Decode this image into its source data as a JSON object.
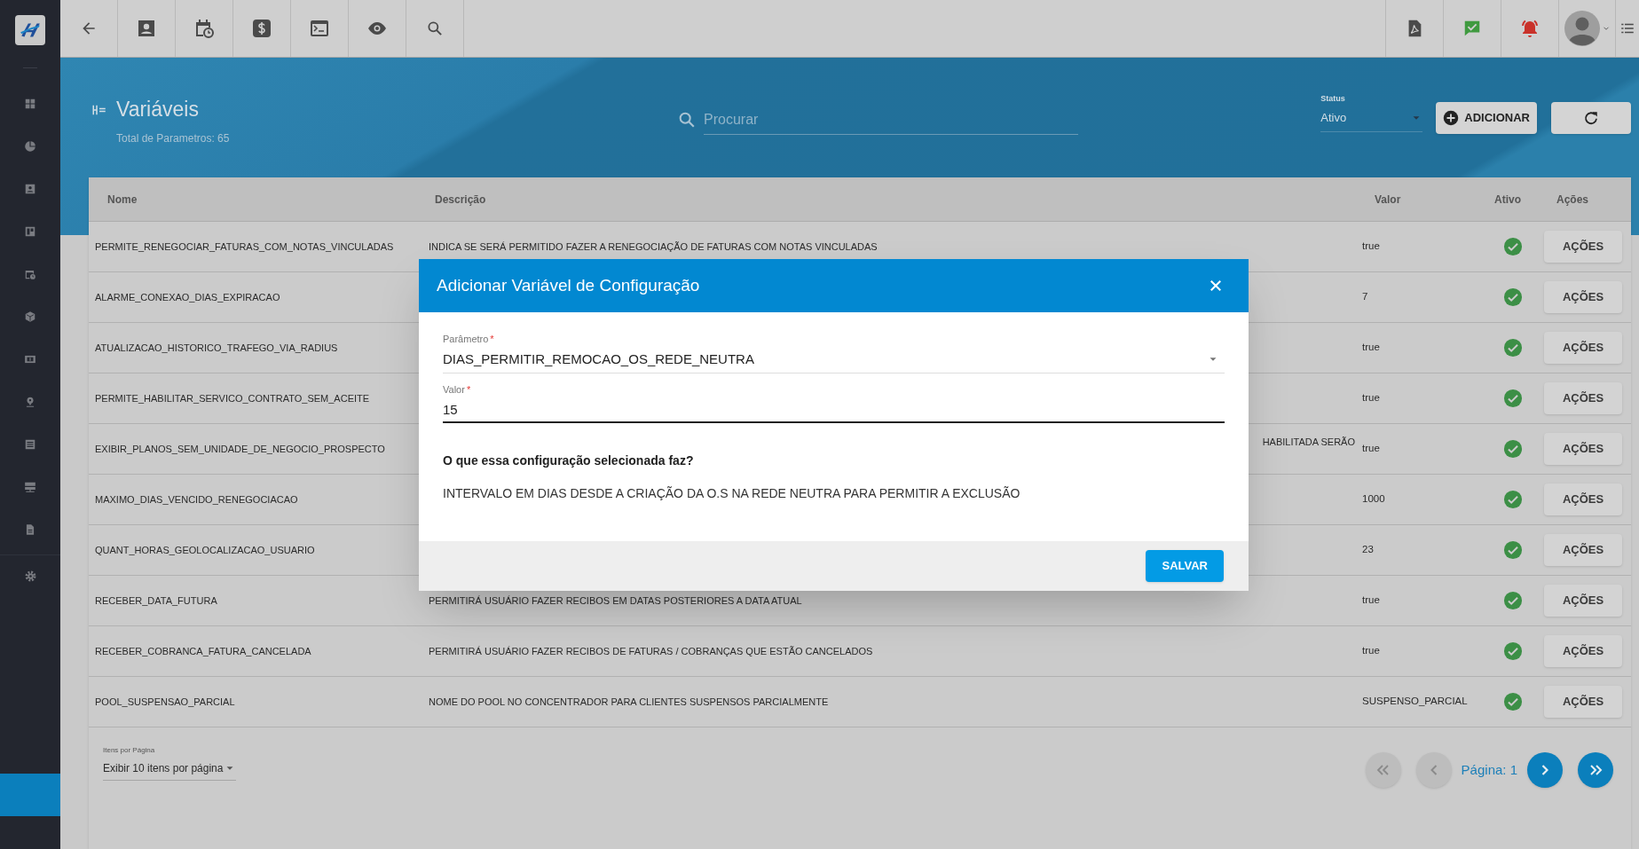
{
  "header": {
    "title": "Variáveis",
    "subtitle": "Total de Parametros: 65",
    "search": {
      "placeholder": "Procurar"
    },
    "status": {
      "label": "Status",
      "value": "Ativo"
    },
    "add_button": "ADICIONAR"
  },
  "table": {
    "columns": [
      "Nome",
      "Descrição",
      "Valor",
      "Ativo",
      "Ações"
    ],
    "rows": [
      {
        "name": "PERMITE_RENEGOCIAR_FATURAS_COM_NOTAS_VINCULADAS",
        "description": "INDICA SE SERÁ PERMITIDO FAZER A RENEGOCIAÇÃO DE FATURAS COM NOTAS VINCULADAS",
        "value": "true",
        "active": true,
        "action": "AÇÕES"
      },
      {
        "name": "ALARME_CONEXAO_DIAS_EXPIRACAO",
        "value": "7",
        "active": true,
        "action": "AÇÕES"
      },
      {
        "name": "ATUALIZACAO_HISTORICO_TRAFEGO_VIA_RADIUS",
        "value": "true",
        "active": true,
        "action": "AÇÕES"
      },
      {
        "name": "PERMITE_HABILITAR_SERVICO_CONTRATO_SEM_ACEITE",
        "value": "true",
        "active": true,
        "action": "AÇÕES"
      },
      {
        "name": "EXIBIR_PLANOS_SEM_UNIDADE_DE_NEGOCIO_PROSPECTO",
        "description_tail": "HABILITADA SERÃO",
        "value": "true",
        "active": true,
        "action": "AÇÕES"
      },
      {
        "name": "MAXIMO_DIAS_VENCIDO_RENEGOCIACAO",
        "value": "1000",
        "active": true,
        "action": "AÇÕES"
      },
      {
        "name": "QUANT_HORAS_GEOLOCALIZACAO_USUARIO",
        "value": "23",
        "active": true,
        "action": "AÇÕES"
      },
      {
        "name": "RECEBER_DATA_FUTURA",
        "description": "PERMITIRÁ USUÁRIO FAZER RECIBOS EM DATAS POSTERIORES A DATA ATUAL",
        "value": "true",
        "active": true,
        "action": "AÇÕES"
      },
      {
        "name": "RECEBER_COBRANCA_FATURA_CANCELADA",
        "description": "PERMITIRÁ USUÁRIO FAZER RECIBOS DE FATURAS / COBRANÇAS QUE ESTÃO CANCELADOS",
        "value": "true",
        "active": true,
        "action": "AÇÕES"
      },
      {
        "name": "POOL_SUSPENSAO_PARCIAL",
        "description": "NOME DO POOL NO CONCENTRADOR PARA CLIENTES SUSPENSOS PARCIALMENTE",
        "value": "SUSPENSO_PARCIAL",
        "active": true,
        "action": "AÇÕES"
      }
    ]
  },
  "pagination": {
    "label": "Itens por Página",
    "value": "Exibir 10 itens por página",
    "page": "Página: 1",
    "nav_buttons": [
      {
        "kind": "first",
        "disabled": true
      },
      {
        "kind": "prev",
        "disabled": true
      },
      {
        "kind": "page"
      },
      {
        "kind": "next",
        "disabled": false
      },
      {
        "kind": "last",
        "disabled": false
      }
    ]
  },
  "dialog": {
    "title": "Adicionar Variável de Configuração",
    "fields": [
      {
        "kind": "select",
        "label": "Parâmetro",
        "required_mark": "*",
        "value": "DIAS_PERMITIR_REMOCAO_OS_REDE_NEUTRA"
      },
      {
        "kind": "input",
        "label": "Valor",
        "required_mark": "*",
        "value": "15",
        "focused": true
      }
    ],
    "question": "O que essa configuração selecionada faz?",
    "answer": "INTERVALO EM DIAS DESDE A CRIAÇÃO DA O.S NA REDE NEUTRA PARA PERMITIR A EXCLUSÃO",
    "save_button": "SALVAR"
  }
}
